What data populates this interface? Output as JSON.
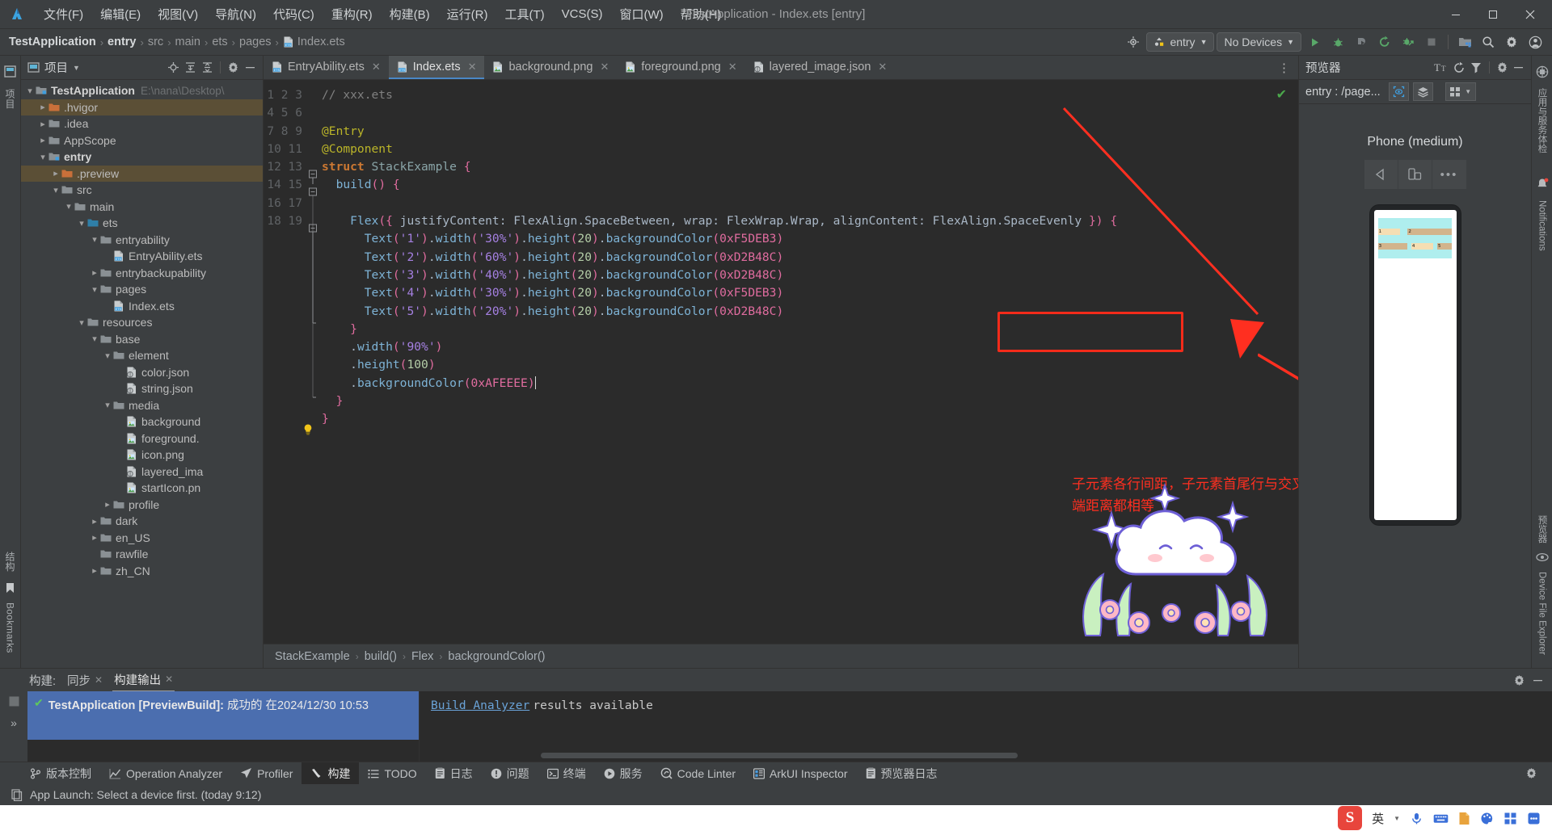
{
  "titlebar": {
    "menus": [
      "文件(F)",
      "编辑(E)",
      "视图(V)",
      "导航(N)",
      "代码(C)",
      "重构(R)",
      "构建(B)",
      "运行(R)",
      "工具(T)",
      "VCS(S)",
      "窗口(W)",
      "帮助(H)"
    ],
    "window_title": "TestApplication - Index.ets [entry]",
    "minimize": "—",
    "maximize": "▢",
    "close": "✕"
  },
  "navbar": {
    "breadcrumbs": [
      "TestApplication",
      "entry",
      "src",
      "main",
      "ets",
      "pages",
      "Index.ets"
    ],
    "separator": "›",
    "module_selector": "entry",
    "device_selector": "No Devices",
    "dropdown_caret": "▼"
  },
  "project_panel": {
    "title": "项目",
    "caret": "▼",
    "tree": [
      {
        "depth": 0,
        "arrow": "v",
        "label": "TestApplication",
        "path": "E:\\nana\\Desktop\\",
        "icon": "module",
        "bold": true,
        "state": "none"
      },
      {
        "depth": 1,
        "arrow": ">",
        "label": ".hvigor",
        "icon": "folder-orange",
        "state": "brown"
      },
      {
        "depth": 1,
        "arrow": ">",
        "label": ".idea",
        "icon": "folder",
        "state": "none"
      },
      {
        "depth": 1,
        "arrow": ">",
        "label": "AppScope",
        "icon": "folder",
        "state": "none"
      },
      {
        "depth": 1,
        "arrow": "v",
        "label": "entry",
        "icon": "module",
        "bold": true,
        "state": "none"
      },
      {
        "depth": 2,
        "arrow": ">",
        "label": ".preview",
        "icon": "folder-orange",
        "state": "brown"
      },
      {
        "depth": 2,
        "arrow": "v",
        "label": "src",
        "icon": "folder",
        "state": "none"
      },
      {
        "depth": 3,
        "arrow": "v",
        "label": "main",
        "icon": "folder",
        "state": "none"
      },
      {
        "depth": 4,
        "arrow": "v",
        "label": "ets",
        "icon": "folder-blue",
        "state": "none"
      },
      {
        "depth": 5,
        "arrow": "v",
        "label": "entryability",
        "icon": "folder",
        "state": "none"
      },
      {
        "depth": 6,
        "arrow": "",
        "label": "EntryAbility.ets",
        "icon": "ets",
        "state": "none"
      },
      {
        "depth": 5,
        "arrow": ">",
        "label": "entrybackupability",
        "icon": "folder",
        "state": "none"
      },
      {
        "depth": 5,
        "arrow": "v",
        "label": "pages",
        "icon": "folder",
        "state": "none"
      },
      {
        "depth": 6,
        "arrow": "",
        "label": "Index.ets",
        "icon": "ets",
        "state": "none"
      },
      {
        "depth": 4,
        "arrow": "v",
        "label": "resources",
        "icon": "folder",
        "state": "none"
      },
      {
        "depth": 5,
        "arrow": "v",
        "label": "base",
        "icon": "folder",
        "state": "none"
      },
      {
        "depth": 6,
        "arrow": "v",
        "label": "element",
        "icon": "folder",
        "state": "none"
      },
      {
        "depth": 7,
        "arrow": "",
        "label": "color.json",
        "icon": "json",
        "state": "none"
      },
      {
        "depth": 7,
        "arrow": "",
        "label": "string.json",
        "icon": "json",
        "state": "none"
      },
      {
        "depth": 6,
        "arrow": "v",
        "label": "media",
        "icon": "folder",
        "state": "none"
      },
      {
        "depth": 7,
        "arrow": "",
        "label": "background",
        "icon": "png",
        "state": "none"
      },
      {
        "depth": 7,
        "arrow": "",
        "label": "foreground.",
        "icon": "png",
        "state": "none"
      },
      {
        "depth": 7,
        "arrow": "",
        "label": "icon.png",
        "icon": "png",
        "state": "none"
      },
      {
        "depth": 7,
        "arrow": "",
        "label": "layered_ima",
        "icon": "json",
        "state": "none"
      },
      {
        "depth": 7,
        "arrow": "",
        "label": "startIcon.pn",
        "icon": "png",
        "state": "none"
      },
      {
        "depth": 6,
        "arrow": ">",
        "label": "profile",
        "icon": "folder",
        "state": "none"
      },
      {
        "depth": 5,
        "arrow": ">",
        "label": "dark",
        "icon": "folder",
        "state": "none"
      },
      {
        "depth": 5,
        "arrow": ">",
        "label": "en_US",
        "icon": "folder",
        "state": "none"
      },
      {
        "depth": 5,
        "arrow": "",
        "label": "rawfile",
        "icon": "folder",
        "state": "none"
      },
      {
        "depth": 5,
        "arrow": ">",
        "label": "zh_CN",
        "icon": "folder",
        "state": "none"
      }
    ]
  },
  "editor": {
    "tabs": [
      {
        "label": "EntryAbility.ets",
        "icon": "ets",
        "active": false,
        "close": "✕"
      },
      {
        "label": "Index.ets",
        "icon": "ets",
        "active": true,
        "close": "✕"
      },
      {
        "label": "background.png",
        "icon": "png",
        "active": false,
        "close": "✕"
      },
      {
        "label": "foreground.png",
        "icon": "png",
        "active": false,
        "close": "✕"
      },
      {
        "label": "layered_image.json",
        "icon": "json",
        "active": false,
        "close": "✕"
      }
    ],
    "more_tabs": "⋮",
    "line_numbers": [
      "1",
      "2",
      "3",
      "4",
      "5",
      "6",
      "7",
      "8",
      "9",
      "10",
      "11",
      "12",
      "13",
      "14",
      "15",
      "16",
      "17",
      "18",
      "19"
    ],
    "code_lines": [
      "// xxx.ets",
      "",
      "@Entry",
      "@Component",
      "struct StackExample {",
      "  build() {",
      "",
      "    Flex({ justifyContent: FlexAlign.SpaceBetween, wrap: FlexWrap.Wrap, alignContent: FlexAlign.SpaceEvenly }) {",
      "      Text('1').width('30%').height(20).backgroundColor(0xF5DEB3)",
      "      Text('2').width('60%').height(20).backgroundColor(0xD2B48C)",
      "      Text('3').width('40%').height(20).backgroundColor(0xD2B48C)",
      "      Text('4').width('30%').height(20).backgroundColor(0xF5DEB3)",
      "      Text('5').width('20%').height(20).backgroundColor(0xD2B48C)",
      "    }",
      "    .width('90%')",
      "    .height(100)",
      "    .backgroundColor(0xAFEEEE)",
      "  }",
      "}"
    ],
    "highlighted_token": "FlexAlign.SpaceEvenly",
    "annotation_line1": "子元素各行间距，子元素首尾行与交叉轴两",
    "annotation_line2": "端距离都相等",
    "annotation_color": "#ff2f20",
    "breadcrumbs": [
      "StackExample",
      "build()",
      "Flex",
      "backgroundColor()"
    ],
    "breadcrumb_sep": "›",
    "inspection_ok": "✔"
  },
  "preview_panel": {
    "title": "预览器",
    "entry_label": "entry : /page...",
    "device_name": "Phone (medium)",
    "controls": [
      "rotate-left",
      "multi-device",
      "more"
    ],
    "more_dots": "•••",
    "dropdown_caret": "▼",
    "render": {
      "container_color": "#afeeee",
      "items": [
        {
          "label": "1",
          "color": "#f5deb3",
          "width_pct": 30
        },
        {
          "label": "2",
          "color": "#d2b48c",
          "width_pct": 60
        },
        {
          "label": "3",
          "color": "#d2b48c",
          "width_pct": 40
        },
        {
          "label": "4",
          "color": "#f5deb3",
          "width_pct": 30
        },
        {
          "label": "5",
          "color": "#d2b48c",
          "width_pct": 20
        }
      ]
    }
  },
  "right_rail": {
    "items": [
      "应用与服务体检",
      "Notifications",
      "预览器",
      "Device File Explorer"
    ]
  },
  "left_rail": {
    "items": [
      "项目",
      "结构",
      "Bookmarks"
    ]
  },
  "bottom_window": {
    "tabs": [
      {
        "label": "构建:",
        "closable": false,
        "active": false
      },
      {
        "label": "同步",
        "closable": true,
        "active": false,
        "close": "✕"
      },
      {
        "label": "构建输出",
        "closable": true,
        "active": true,
        "close": "✕"
      }
    ],
    "build_status_icon": "✔",
    "build_status_bold": "TestApplication [PreviewBuild]:",
    "build_status_text": "成功的 在2024/12/30 10:53",
    "analyzer_link": "Build Analyzer",
    "analyzer_rest": "results available",
    "expand": "»"
  },
  "tool_strip": {
    "items": [
      {
        "label": "版本控制",
        "icon": "branch-icon",
        "active": false
      },
      {
        "label": "Operation Analyzer",
        "icon": "chart-icon",
        "active": false
      },
      {
        "label": "Profiler",
        "icon": "profiler-icon",
        "active": false
      },
      {
        "label": "构建",
        "icon": "hammer-icon",
        "active": true
      },
      {
        "label": "TODO",
        "icon": "list-icon",
        "active": false
      },
      {
        "label": "日志",
        "icon": "log-icon",
        "active": false
      },
      {
        "label": "问题",
        "icon": "warning-icon",
        "active": false
      },
      {
        "label": "终端",
        "icon": "terminal-icon",
        "active": false
      },
      {
        "label": "服务",
        "icon": "services-icon",
        "active": false
      },
      {
        "label": "Code Linter",
        "icon": "linter-icon",
        "active": false
      },
      {
        "label": "ArkUI Inspector",
        "icon": "inspector-icon",
        "active": false
      },
      {
        "label": "预览器日志",
        "icon": "log2-icon",
        "active": false
      }
    ]
  },
  "status_bar": {
    "message": "App Launch: Select a device first. (today 9:12)"
  },
  "ime_bar": {
    "logo": "S",
    "mode": "英",
    "items": [
      "mic-icon",
      "keyboard-icon",
      "doc-icon",
      "palette-icon",
      "apps-icon",
      "more-icon"
    ]
  },
  "colors": {
    "accent_blue": "#4a88c7",
    "selection_blue": "#4b6eaf",
    "annotation_red": "#ff2f20",
    "editor_bg": "#2b2b2b",
    "panel_bg": "#3c3f41"
  }
}
